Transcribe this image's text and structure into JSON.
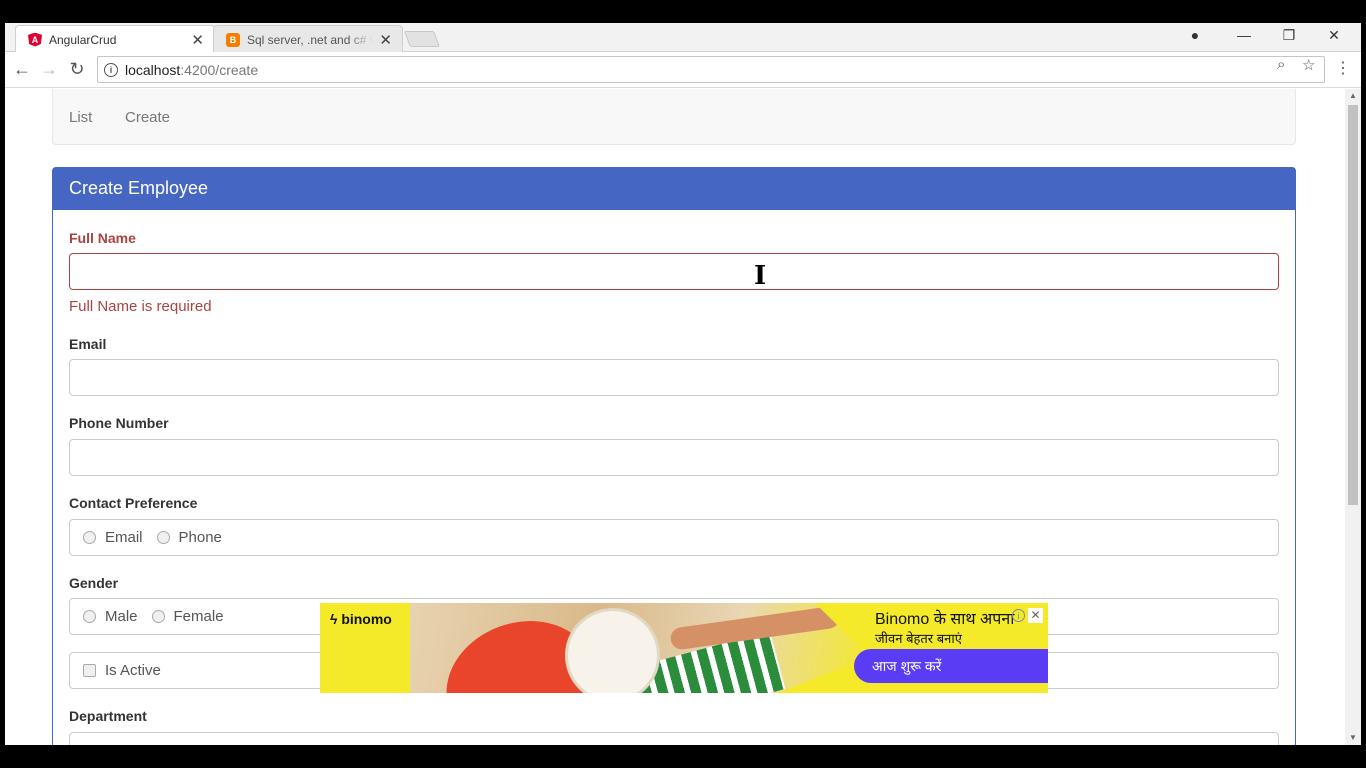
{
  "browser": {
    "tabs": [
      {
        "title": "AngularCrud",
        "favicon": "angular-icon"
      },
      {
        "title": "Sql server, .net and c# vid",
        "favicon": "blogger-icon"
      }
    ],
    "url_host": "localhost",
    "url_path": ":4200/create"
  },
  "nav": {
    "list_label": "List",
    "create_label": "Create"
  },
  "form": {
    "heading": "Create Employee",
    "full_name_label": "Full Name",
    "full_name_value": "",
    "full_name_error": "Full Name is required",
    "email_label": "Email",
    "email_value": "",
    "phone_label": "Phone Number",
    "phone_value": "",
    "contact_pref_label": "Contact Preference",
    "contact_options": [
      "Email",
      "Phone"
    ],
    "gender_label": "Gender",
    "gender_options": [
      "Male",
      "Female"
    ],
    "is_active_label": "Is Active",
    "department_label": "Department"
  },
  "ad": {
    "brand": "binomo",
    "headline": "Binomo के साथ अपना",
    "subline": "जीवन बेहतर बनाएं",
    "cta": "आज शुरू करें"
  },
  "colors": {
    "panel_primary": "#4566c2",
    "error": "#a94442",
    "ad_background": "#f4ea2a",
    "ad_cta": "#5b3cf5"
  }
}
